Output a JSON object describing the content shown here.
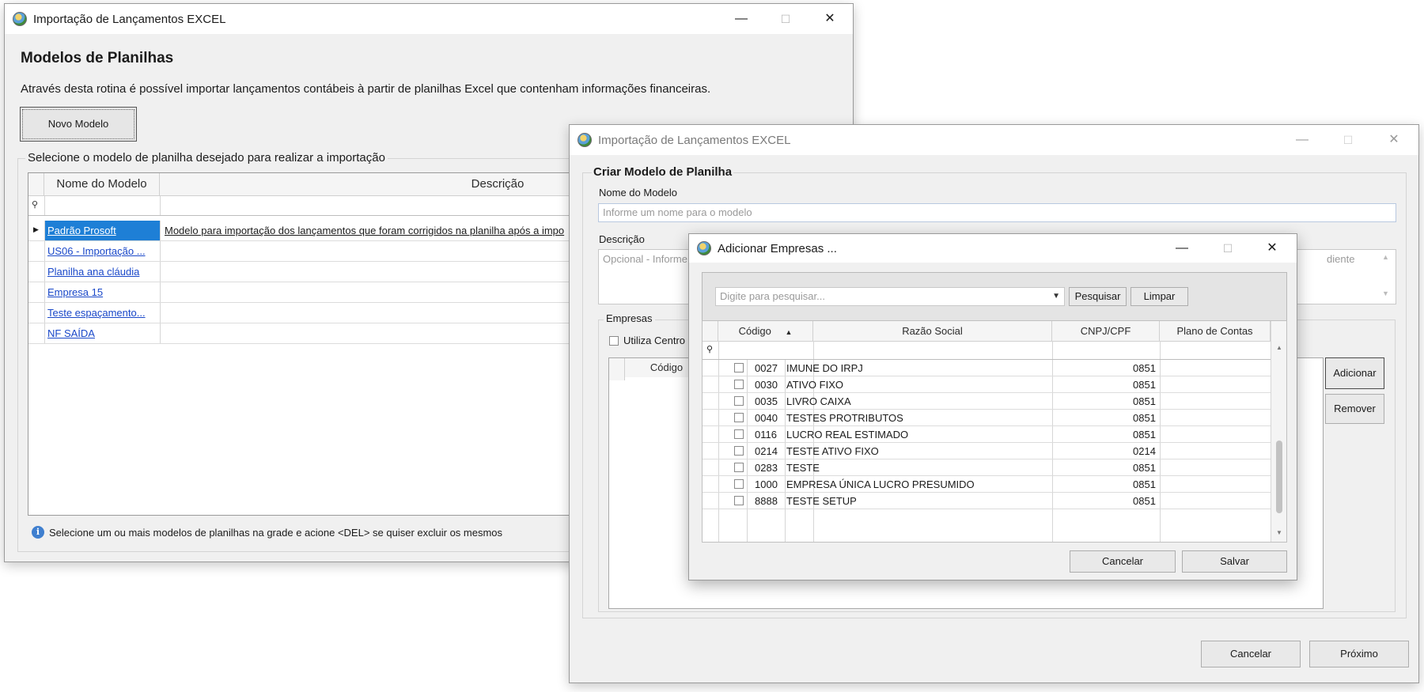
{
  "main_window": {
    "title": "Importação de Lançamentos EXCEL",
    "heading": "Modelos de Planilhas",
    "description": "Através desta rotina é possível importar lançamentos contábeis à partir de planilhas Excel que contenham informações financeiras.",
    "new_model_button": "Novo Modelo",
    "group_label": "Selecione o modelo de planilha desejado para realizar a importação",
    "columns": [
      "Nome do Modelo",
      "Descrição"
    ],
    "rows": [
      {
        "name": "Padrão Prosoft",
        "description": "Modelo para importação dos lançamentos que foram corrigidos na planilha após a impo"
      },
      {
        "name": "US06 - Importação ...",
        "description": ""
      },
      {
        "name": "Planilha ana cláudia",
        "description": ""
      },
      {
        "name": "Empresa 15",
        "description": ""
      },
      {
        "name": "Teste espaçamento...",
        "description": ""
      },
      {
        "name": "NF SAÍDA",
        "description": ""
      }
    ],
    "hint": "Selecione um ou mais modelos de planilhas na grade e acione <DEL> se quiser excluir os mesmos"
  },
  "create_window": {
    "title": "Importação de Lançamentos EXCEL",
    "heading": "Criar Modelo de Planilha",
    "name_label": "Nome do Modelo",
    "name_placeholder": "Informe um nome para o modelo",
    "desc_label": "Descrição",
    "desc_placeholder_left": "Opcional - Informe",
    "desc_placeholder_right": "diente",
    "empresas_label": "Empresas",
    "centro_checkbox_label": "Utiliza Centro",
    "inner_col_codigo": "Código",
    "add_button": "Adicionar",
    "remove_button": "Remover",
    "cancel_button": "Cancelar",
    "next_button": "Próximo"
  },
  "dialog": {
    "title": "Adicionar Empresas ...",
    "search_placeholder": "Digite para pesquisar...",
    "search_button": "Pesquisar",
    "clear_button": "Limpar",
    "columns": [
      "Código",
      "Razão Social",
      "CNPJ/CPF",
      "Plano de Contas"
    ],
    "rows": [
      {
        "codigo": "0027",
        "razao": "IMUNE DO IRPJ",
        "cnpj": "",
        "plano": "0851"
      },
      {
        "codigo": "0030",
        "razao": "ATIVO FIXO",
        "cnpj": "",
        "plano": "0851"
      },
      {
        "codigo": "0035",
        "razao": "LIVRO CAIXA",
        "cnpj": "",
        "plano": "0851"
      },
      {
        "codigo": "0040",
        "razao": "TESTES PROTRIBUTOS",
        "cnpj": "",
        "plano": "0851"
      },
      {
        "codigo": "0116",
        "razao": "LUCRO REAL ESTIMADO",
        "cnpj": "",
        "plano": "0851"
      },
      {
        "codigo": "0214",
        "razao": "TESTE ATIVO FIXO",
        "cnpj": "",
        "plano": "0214"
      },
      {
        "codigo": "0283",
        "razao": "TESTE",
        "cnpj": "",
        "plano": "0851"
      },
      {
        "codigo": "1000",
        "razao": "EMPRESA ÚNICA LUCRO PRESUMIDO",
        "cnpj": "",
        "plano": "0851"
      },
      {
        "codigo": "8888",
        "razao": "TESTE SETUP",
        "cnpj": "",
        "plano": "0851"
      }
    ],
    "cancel_button": "Cancelar",
    "save_button": "Salvar"
  },
  "window_controls": {
    "minimize": "—",
    "maximize": "☐",
    "close": "✕"
  },
  "icons": {
    "info": "info-icon",
    "pin": "pin-icon",
    "row_indicator": "row-indicator-icon",
    "sort_up": "sort-ascending-icon",
    "dropdown": "chevron-down-icon"
  },
  "colors": {
    "selection": "#1e7fd6",
    "link": "#1a48c9",
    "window_bg": "#f0f0f0"
  }
}
